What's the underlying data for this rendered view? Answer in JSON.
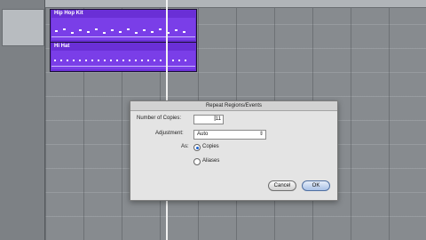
{
  "tracks": [
    {
      "name": "Hip Hop Kit"
    },
    {
      "name": "Hi Hat"
    }
  ],
  "dialog": {
    "title": "Repeat Regions/Events",
    "copies_label": "Number of Copies:",
    "copies_value": "11",
    "adjustment_label": "Adjustment:",
    "adjustment_value": "Auto",
    "as_label": "As:",
    "option_copies": "Copies",
    "option_aliases": "Aliases",
    "selected_option": "Copies",
    "cancel_label": "Cancel",
    "ok_label": "OK"
  },
  "colors": {
    "region": "#6a2fd6",
    "accent": "#1a5fd0"
  }
}
